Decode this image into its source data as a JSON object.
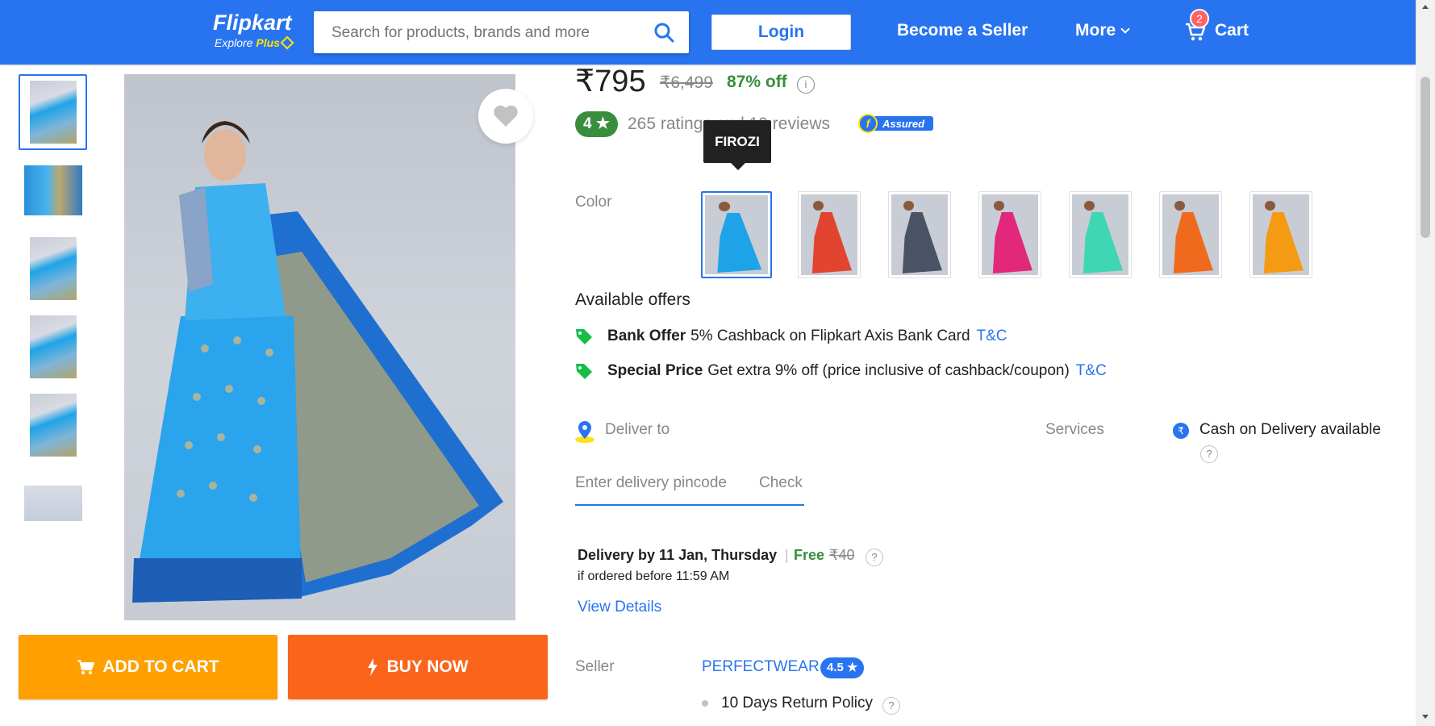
{
  "header": {
    "logo": "Flipkart",
    "logo_sub_explore": "Explore",
    "logo_sub_plus": "Plus",
    "search_placeholder": "Search for products, brands and more",
    "login_label": "Login",
    "seller_label": "Become a Seller",
    "more_label": "More",
    "cart_label": "Cart",
    "cart_count": "2",
    "brand_color": "#2874f0"
  },
  "gallery": {
    "thumbnails": [
      "thumb-1",
      "thumb-2",
      "thumb-3",
      "thumb-4",
      "thumb-5",
      "thumb-6"
    ],
    "active_index": 0
  },
  "actions": {
    "add_to_cart": "ADD TO CART",
    "buy_now": "BUY NOW"
  },
  "pricing": {
    "price": "₹795",
    "mrp": "₹6,499",
    "discount": "87% off",
    "info": "i"
  },
  "rating": {
    "score": "4",
    "star": "★",
    "text": "265 ratings and 19 reviews",
    "assured": "Assured"
  },
  "color": {
    "label": "Color",
    "tooltip": "FIROZI",
    "swatches": [
      {
        "color": "#1fa3e8"
      },
      {
        "color": "#e2442f"
      },
      {
        "color": "#4a5366"
      },
      {
        "color": "#e3287c"
      },
      {
        "color": "#3fd6b3"
      },
      {
        "color": "#f06a1e"
      },
      {
        "color": "#f59a13"
      }
    ]
  },
  "offers": {
    "title": "Available offers",
    "items": [
      {
        "type": "Bank Offer",
        "text": "5% Cashback on Flipkart Axis Bank Card",
        "link": "T&C"
      },
      {
        "type": "Special Price",
        "text": "Get extra 9% off (price inclusive of cashback/coupon)",
        "link": "T&C"
      }
    ]
  },
  "delivery": {
    "deliver_to": "Deliver to",
    "pincode_placeholder": "Enter delivery pincode",
    "check": "Check",
    "delivery_by": "Delivery by 11 Jan, Thursday",
    "pipe": "|",
    "free": "Free",
    "free_strike": "₹40",
    "ordered_before": "if ordered before 11:59 AM",
    "view_details": "View Details"
  },
  "services": {
    "label": "Services",
    "cod_icon": "₹",
    "cod": "Cash on Delivery available",
    "help": "?"
  },
  "seller": {
    "label": "Seller",
    "name": "PERFECTWEAR",
    "rating": "4.5 ★",
    "policy": "10 Days Return Policy"
  }
}
